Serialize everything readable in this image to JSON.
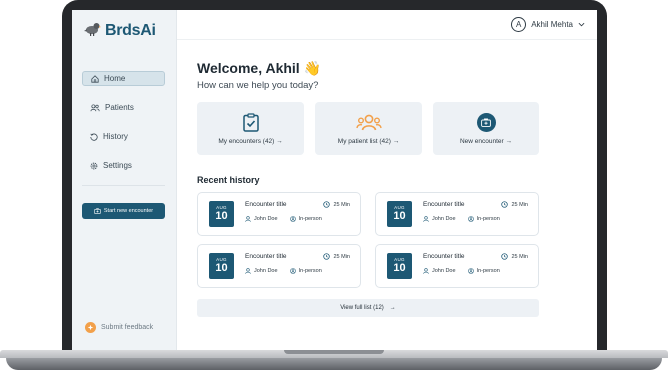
{
  "brand": {
    "name": "BrdsAi"
  },
  "user": {
    "initial": "A",
    "name": "Akhil Mehta"
  },
  "sidebar": {
    "items": [
      {
        "label": "Home",
        "icon": "home-icon",
        "active": true
      },
      {
        "label": "Patients",
        "icon": "users-icon",
        "active": false
      },
      {
        "label": "History",
        "icon": "history-icon",
        "active": false
      },
      {
        "label": "Settings",
        "icon": "gear-icon",
        "active": false
      }
    ],
    "start_button": "Start new encounter",
    "feedback": "Submit feedback"
  },
  "main": {
    "welcome": "Welcome, Akhil 👋",
    "subtitle": "How can we help you today?",
    "cards": [
      {
        "label": "My encounters (42) →",
        "icon": "clipboard-check-icon"
      },
      {
        "label": "My patient list (42) →",
        "icon": "patients-group-icon"
      },
      {
        "label": "New encounter →",
        "icon": "medical-bag-icon"
      }
    ],
    "recent_title": "Recent history",
    "history": [
      {
        "month": "AUG",
        "day": "10",
        "title": "Encounter title",
        "duration": "25 Min",
        "patient": "John Doe",
        "mode": "In-person"
      },
      {
        "month": "AUG",
        "day": "10",
        "title": "Encounter title",
        "duration": "25 Min",
        "patient": "John Doe",
        "mode": "In-person"
      },
      {
        "month": "AUG",
        "day": "10",
        "title": "Encounter title",
        "duration": "25 Min",
        "patient": "John Doe",
        "mode": "In-person"
      },
      {
        "month": "AUG",
        "day": "10",
        "title": "Encounter title",
        "duration": "25 Min",
        "patient": "John Doe",
        "mode": "In-person"
      }
    ],
    "view_full": "View full list (12)",
    "view_full_arrow": "→"
  },
  "colors": {
    "primary": "#1d5874",
    "accent": "#f2a04a",
    "sidebar_bg": "#eff3f6",
    "card_bg": "#edf1f5"
  }
}
